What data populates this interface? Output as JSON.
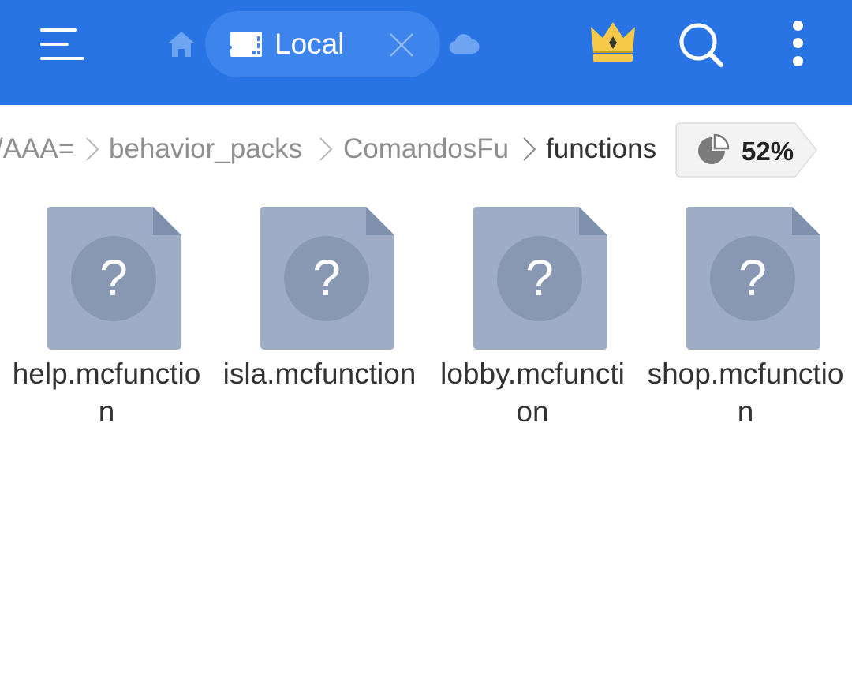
{
  "toolbar": {
    "menu_icon": "hamburger-menu-icon",
    "home_icon": "home-icon",
    "tab": {
      "label": "Local",
      "icon": "sd-card-icon",
      "close_icon": "close-icon"
    },
    "cloud_icon": "cloud-icon",
    "premium_icon": "crown-icon",
    "search_icon": "search-icon",
    "more_icon": "more-vertical-icon",
    "colors": {
      "bar": "#2874e4",
      "tab": "#3d84ec",
      "crown": "#f7c94b"
    }
  },
  "breadcrumb": {
    "items": [
      {
        "label": "/AAA="
      },
      {
        "label": "behavior_packs"
      },
      {
        "label": "ComandosFu"
      },
      {
        "label": "functions"
      }
    ],
    "separator_icon": "chevron-right-icon",
    "storage": {
      "percent_label": "52%",
      "used_fraction": 0.52,
      "icon": "pie-chart-icon"
    }
  },
  "files": [
    {
      "name": "help.mcfunction",
      "icon": "unknown-file-icon"
    },
    {
      "name": "isla.mcfunction",
      "icon": "unknown-file-icon"
    },
    {
      "name": "lobby.mcfunction",
      "icon": "unknown-file-icon"
    },
    {
      "name": "shop.mcfunction",
      "icon": "unknown-file-icon"
    }
  ],
  "file_icon_colors": {
    "page": "#9eacc6",
    "fold": "#7f90ad",
    "circle": "#8897b2",
    "glyph": "#ffffff"
  }
}
